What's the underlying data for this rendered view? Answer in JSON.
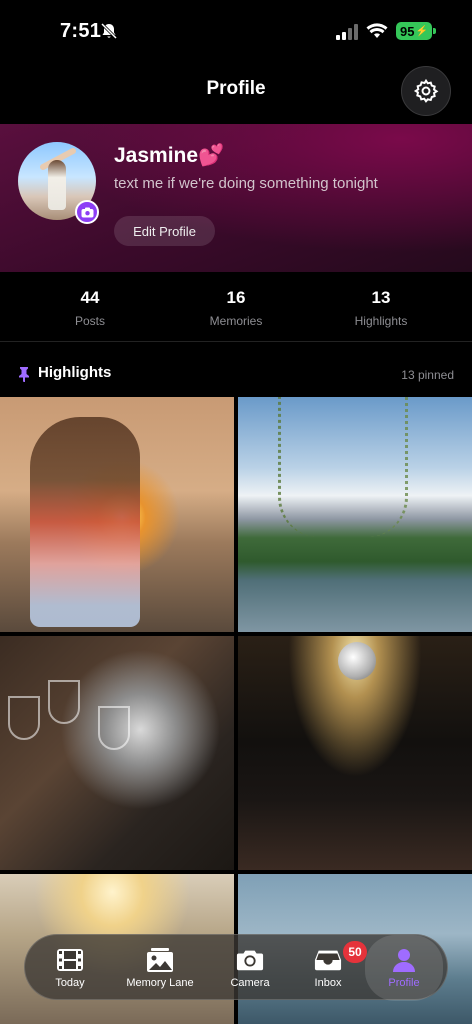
{
  "status_bar": {
    "time": "7:51",
    "battery": "95"
  },
  "header": {
    "title": "Profile"
  },
  "profile": {
    "name": "Jasmine💕",
    "bio": "text me if we're doing something tonight",
    "edit_label": "Edit Profile"
  },
  "stats": [
    {
      "value": "44",
      "label": "Posts"
    },
    {
      "value": "16",
      "label": "Memories"
    },
    {
      "value": "13",
      "label": "Highlights"
    }
  ],
  "highlights": {
    "title": "Highlights",
    "pinned": "13 pinned"
  },
  "tabs": [
    {
      "label": "Today",
      "icon": "film-icon"
    },
    {
      "label": "Memory Lane",
      "icon": "photos-icon"
    },
    {
      "label": "Camera",
      "icon": "camera-icon"
    },
    {
      "label": "Inbox",
      "icon": "inbox-icon",
      "badge": "50"
    },
    {
      "label": "Profile",
      "icon": "person-icon",
      "active": true
    }
  ],
  "colors": {
    "accent": "#9f6cff",
    "badge": "#e5333b",
    "card": "#5a0f3e"
  }
}
